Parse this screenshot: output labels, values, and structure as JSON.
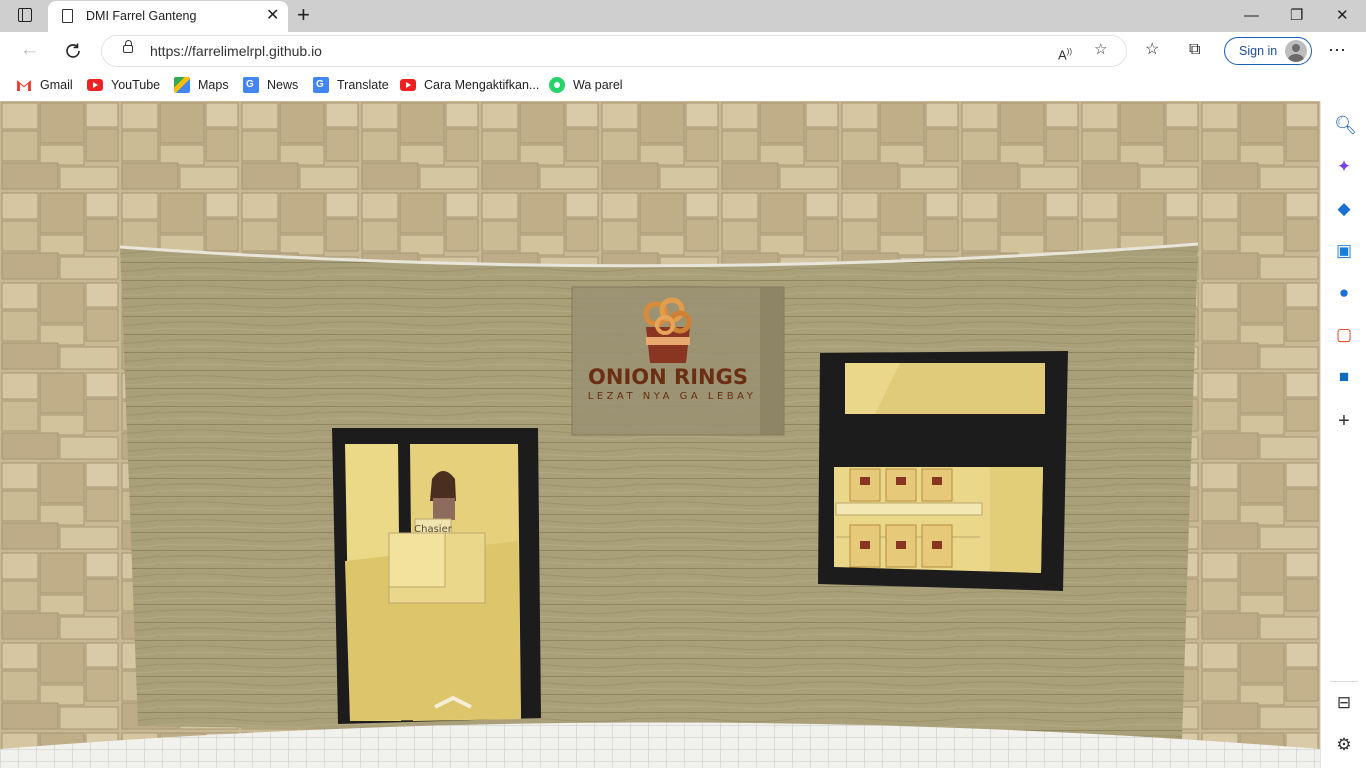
{
  "browser": {
    "tab_title": "DMI Farrel Ganteng",
    "tab_close": "✕",
    "new_tab": "+",
    "url": "https://farrelimelrpl.github.io",
    "sign_in_label": "Sign in",
    "window_controls": {
      "minimize": "—",
      "restore": "❐",
      "close": "✕"
    },
    "bookmarks": [
      {
        "label": "Gmail",
        "icon": "gmail-icon"
      },
      {
        "label": "YouTube",
        "icon": "youtube-icon"
      },
      {
        "label": "Maps",
        "icon": "maps-icon"
      },
      {
        "label": "News",
        "icon": "news-icon"
      },
      {
        "label": "Translate",
        "icon": "translate-icon"
      },
      {
        "label": "Cara Mengaktifkan...",
        "icon": "youtube-icon"
      },
      {
        "label": "Wa parel",
        "icon": "whatsapp-icon"
      }
    ]
  },
  "scene": {
    "sign_title": "ONION RINGS",
    "sign_tagline": "LEZAT NYA GA LEBAY",
    "cashier_label": "Chasier",
    "colors": {
      "sign_text": "#6b2e13",
      "door_frame": "#1c1c1c",
      "interior": "#ecd987"
    }
  },
  "sidebar": {
    "icons": [
      "search-icon",
      "copilot-icon",
      "shopping-icon",
      "tools-icon",
      "games-icon",
      "office-icon",
      "outlook-icon",
      "add-icon",
      "split-screen-icon",
      "settings-icon"
    ]
  }
}
